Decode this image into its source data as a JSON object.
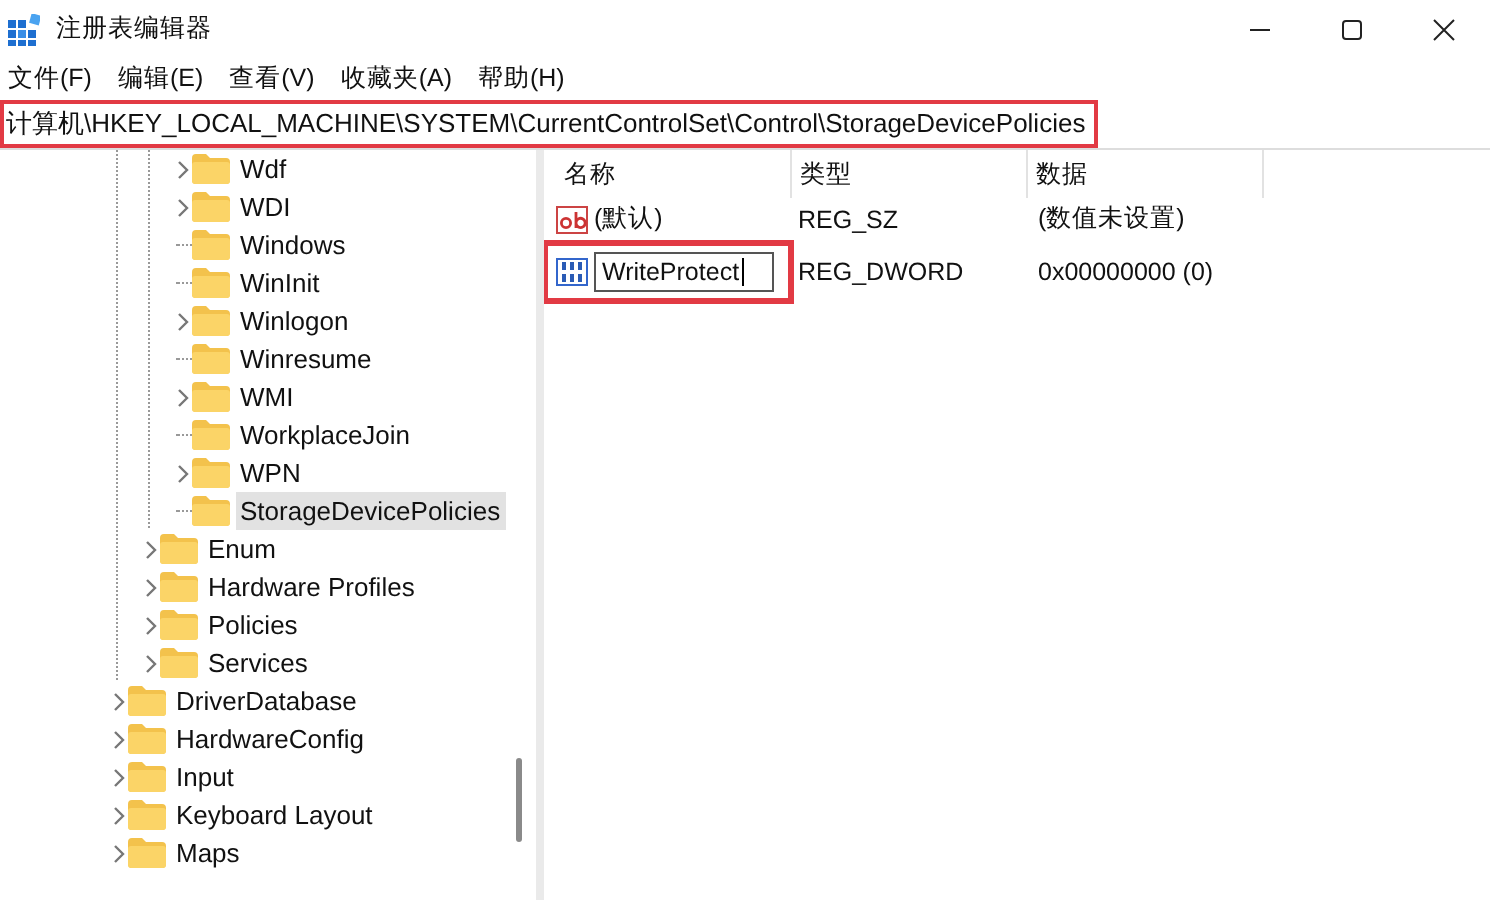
{
  "window": {
    "title": "注册表编辑器"
  },
  "menu": [
    "文件(F)",
    "编辑(E)",
    "查看(V)",
    "收藏夹(A)",
    "帮助(H)"
  ],
  "address": {
    "path": "计算机\\HKEY_LOCAL_MACHINE\\SYSTEM\\CurrentControlSet\\Control\\StorageDevicePolicies",
    "highlighted": true
  },
  "tree": {
    "items": [
      {
        "children": [
          {
            "children": [
              {
                "label": "Wdf",
                "expandable": true,
                "selected": false
              },
              {
                "label": "WDI",
                "expandable": true,
                "selected": false
              },
              {
                "label": "Windows",
                "expandable": false,
                "selected": false
              },
              {
                "label": "WinInit",
                "expandable": false,
                "selected": false
              },
              {
                "label": "Winlogon",
                "expandable": true,
                "selected": false
              },
              {
                "label": "Winresume",
                "expandable": false,
                "selected": false
              },
              {
                "label": "WMI",
                "expandable": true,
                "selected": false
              },
              {
                "label": "WorkplaceJoin",
                "expandable": false,
                "selected": false
              },
              {
                "label": "WPN",
                "expandable": true,
                "selected": false
              },
              {
                "label": "StorageDevicePolicies",
                "expandable": false,
                "selected": true
              }
            ]
          },
          {
            "label": "Enum",
            "expandable": true,
            "selected": false
          },
          {
            "label": "Hardware Profiles",
            "expandable": true,
            "selected": false
          },
          {
            "label": "Policies",
            "expandable": true,
            "selected": false
          },
          {
            "label": "Services",
            "expandable": true,
            "selected": false
          }
        ]
      },
      {
        "label": "DriverDatabase",
        "expandable": true,
        "selected": false
      },
      {
        "label": "HardwareConfig",
        "expandable": true,
        "selected": false
      },
      {
        "label": "Input",
        "expandable": true,
        "selected": false
      },
      {
        "label": "Keyboard Layout",
        "expandable": true,
        "selected": false
      },
      {
        "label": "Maps",
        "expandable": true,
        "selected": false
      }
    ]
  },
  "values": {
    "columns": [
      "名称",
      "类型",
      "数据"
    ],
    "rows": [
      {
        "kind": "string",
        "name": "(默认)",
        "type": "REG_SZ",
        "data": "(数值未设置)",
        "editing": false,
        "highlighted": false
      },
      {
        "kind": "dword",
        "name": "WriteProtect",
        "type": "REG_DWORD",
        "data": "0x00000000 (0)",
        "editing": true,
        "highlighted": true
      }
    ]
  }
}
